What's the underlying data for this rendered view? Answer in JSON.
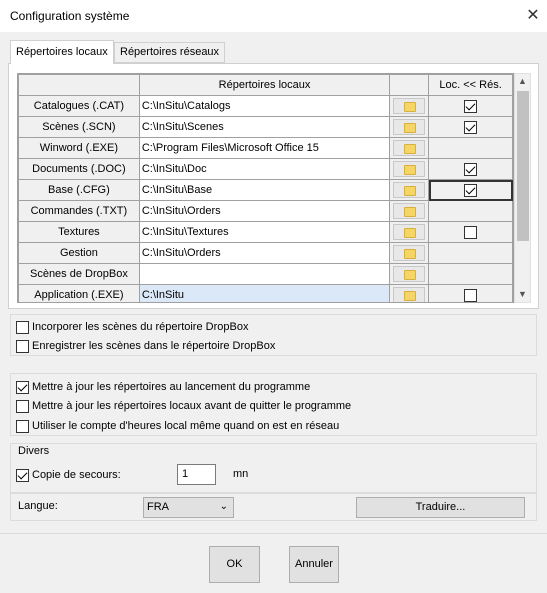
{
  "window": {
    "title": "Configuration système"
  },
  "tabs": [
    {
      "label": "Répertoires locaux",
      "active": true
    },
    {
      "label": "Répertoires réseaux",
      "active": false
    }
  ],
  "grid": {
    "columns": [
      "",
      "Répertoires locaux",
      "",
      "Loc. << Rés."
    ],
    "rows": [
      {
        "label": "Catalogues (.CAT)",
        "path": "C:\\InSitu\\Catalogs",
        "checkbox": true,
        "checked": true
      },
      {
        "label": "Scènes (.SCN)",
        "path": "C:\\InSitu\\Scenes",
        "checkbox": true,
        "checked": true
      },
      {
        "label": "Winword (.EXE)",
        "path": "C:\\Program Files\\Microsoft Office 15",
        "checkbox": false,
        "checked": false
      },
      {
        "label": "Documents (.DOC)",
        "path": "C:\\InSitu\\Doc",
        "checkbox": true,
        "checked": true
      },
      {
        "label": "Base (.CFG)",
        "path": "C:\\InSitu\\Base",
        "checkbox": true,
        "checked": true
      },
      {
        "label": "Commandes (.TXT)",
        "path": "C:\\InSitu\\Orders",
        "checkbox": false,
        "checked": false
      },
      {
        "label": "Textures",
        "path": "C:\\InSitu\\Textures",
        "checkbox": true,
        "checked": false
      },
      {
        "label": "Gestion",
        "path": "C:\\InSitu\\Orders",
        "checkbox": false,
        "checked": false
      },
      {
        "label": "Scènes de DropBox",
        "path": "",
        "checkbox": false,
        "checked": false
      },
      {
        "label": "Application (.EXE)",
        "path": "C:\\InSitu",
        "checkbox": true,
        "checked": false
      }
    ]
  },
  "dropbox_options": [
    {
      "label": "Incorporer les scènes du répertoire DropBox",
      "checked": false
    },
    {
      "label": "Enregistrer les scènes dans le répertoire DropBox",
      "checked": false
    }
  ],
  "update_options": [
    {
      "label": "Mettre à jour les répertoires au lancement du programme",
      "checked": true
    },
    {
      "label": "Mettre à jour les répertoires locaux avant de quitter le programme",
      "checked": false
    },
    {
      "label": "Utiliser le compte d'heures local même quand on est en réseau",
      "checked": false
    }
  ],
  "divers": {
    "title": "Divers",
    "backup_label": "Copie de secours:",
    "backup_checked": true,
    "backup_value": "1",
    "backup_unit": "mn"
  },
  "language": {
    "label": "Langue:",
    "value": "FRA",
    "translate_button": "Traduire..."
  },
  "buttons": {
    "ok": "OK",
    "cancel": "Annuler"
  }
}
